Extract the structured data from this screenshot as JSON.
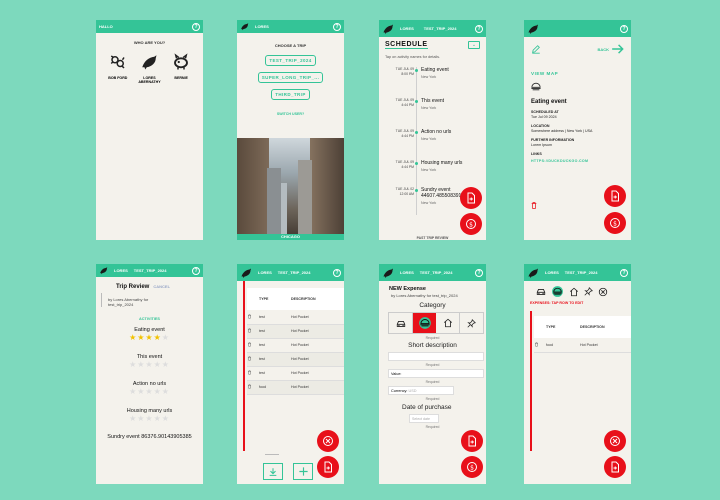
{
  "colors": {
    "accent": "#34c497",
    "danger": "#e8101a",
    "background": "#7dd9bd",
    "panel": "#f4f2ec"
  },
  "who": {
    "header": "HALLO",
    "title": "WHO ARE YOU?",
    "users": [
      {
        "name": "BOB FORD",
        "icon": "bug-icon"
      },
      {
        "name": "LORES ABERNATHY",
        "icon": "bird-icon"
      },
      {
        "name": "BERNIE",
        "icon": "pig-icon"
      }
    ]
  },
  "trip": {
    "header": "LORES",
    "title": "CHOOSE A TRIP",
    "trips": [
      "TEST_TRIP_2024",
      "SUPER_LONG_TRIP_...",
      "THIRD_TRIP"
    ],
    "switch": "SWITCH USER?",
    "caption": "CHICAGO"
  },
  "schedule": {
    "header_user": "LORES",
    "header_trip": "TEST_TRIP_2024",
    "title": "SCHEDULE",
    "hint": "Tap on activity names for details.",
    "events": [
      {
        "date": "TUE JUL 09",
        "time": "8:00 PM",
        "name": "Eating event",
        "place": "New York"
      },
      {
        "date": "TUE JUL 09",
        "time": "4:44 PM",
        "name": "This event",
        "place": "New York"
      },
      {
        "date": "TUE JUL 09",
        "time": "4:44 PM",
        "name": "Action no urls",
        "place": "New York"
      },
      {
        "date": "TUE JUL 09",
        "time": "4:44 PM",
        "name": "Housing many urls",
        "place": "New York"
      },
      {
        "date": "TUE JUL 02",
        "time": "12:00 AM",
        "name": "Sundry event 44607.485508391",
        "place": "New York"
      }
    ],
    "footer": "PAST TRIP REVIEW"
  },
  "detail": {
    "back": "BACK",
    "view_map": "VIEW MAP",
    "title": "Eating event",
    "scheduled_label": "SCHEDULED AT",
    "scheduled": "Tue Jul 09 2024",
    "location_label": "LOCATION",
    "location": "Somewhere address | New York | USA",
    "further_label": "FURTHER INFORMATION",
    "further": "Lorem Ipsum",
    "links_label": "LINKS",
    "link": "HTTPS://DUCKDUCKGO.COM"
  },
  "review": {
    "header_user": "LORES",
    "header_trip": "TEST_TRIP_2024",
    "title": "Trip Review",
    "cancel": "CANCEL",
    "by": "by Lores Abernathy for test_trip_2024",
    "activities_label": "ACTIVITIES",
    "items": [
      {
        "name": "Eating event",
        "rating": 4
      },
      {
        "name": "This event",
        "rating": 0
      },
      {
        "name": "Action no urls",
        "rating": 0
      },
      {
        "name": "Housing many urls",
        "rating": 0
      },
      {
        "name": "Sundry event 86376.90143905385",
        "rating": 0
      }
    ]
  },
  "expenses": {
    "header_user": "LORES",
    "header_trip": "TEST_TRIP_2024",
    "col_type": "TYPE",
    "col_desc": "DESCRIPTION",
    "rows": [
      {
        "type": "test",
        "desc": "Hot Pocket"
      },
      {
        "type": "test",
        "desc": "Hot Pocket"
      },
      {
        "type": "test",
        "desc": "Hot Pocket"
      },
      {
        "type": "test",
        "desc": "Hot Pocket"
      },
      {
        "type": "test",
        "desc": "Hot Pocket"
      },
      {
        "type": "food",
        "desc": "Hot Pocket"
      }
    ]
  },
  "new_expense": {
    "header_user": "LORES",
    "header_trip": "TEST_TRIP_2024",
    "title": "NEW Expense",
    "by": "by Lores Abernathy for test_trip_2024",
    "category_label": "Category",
    "required": "Required",
    "short_desc_label": "Short description",
    "value_label": "Value:",
    "currency_label": "Currency:",
    "currency_placeholder": "USD",
    "date_label": "Date of purchase",
    "date_placeholder": "Select date"
  },
  "expenses2": {
    "header_user": "LORES",
    "header_trip": "TEST_TRIP_2024",
    "notice": "EXPENSES: TAP ROW TO EDIT",
    "col_type": "TYPE",
    "col_desc": "DESCRIPTION",
    "rows": [
      {
        "type": "food",
        "desc": "Hot Pocket"
      }
    ]
  }
}
